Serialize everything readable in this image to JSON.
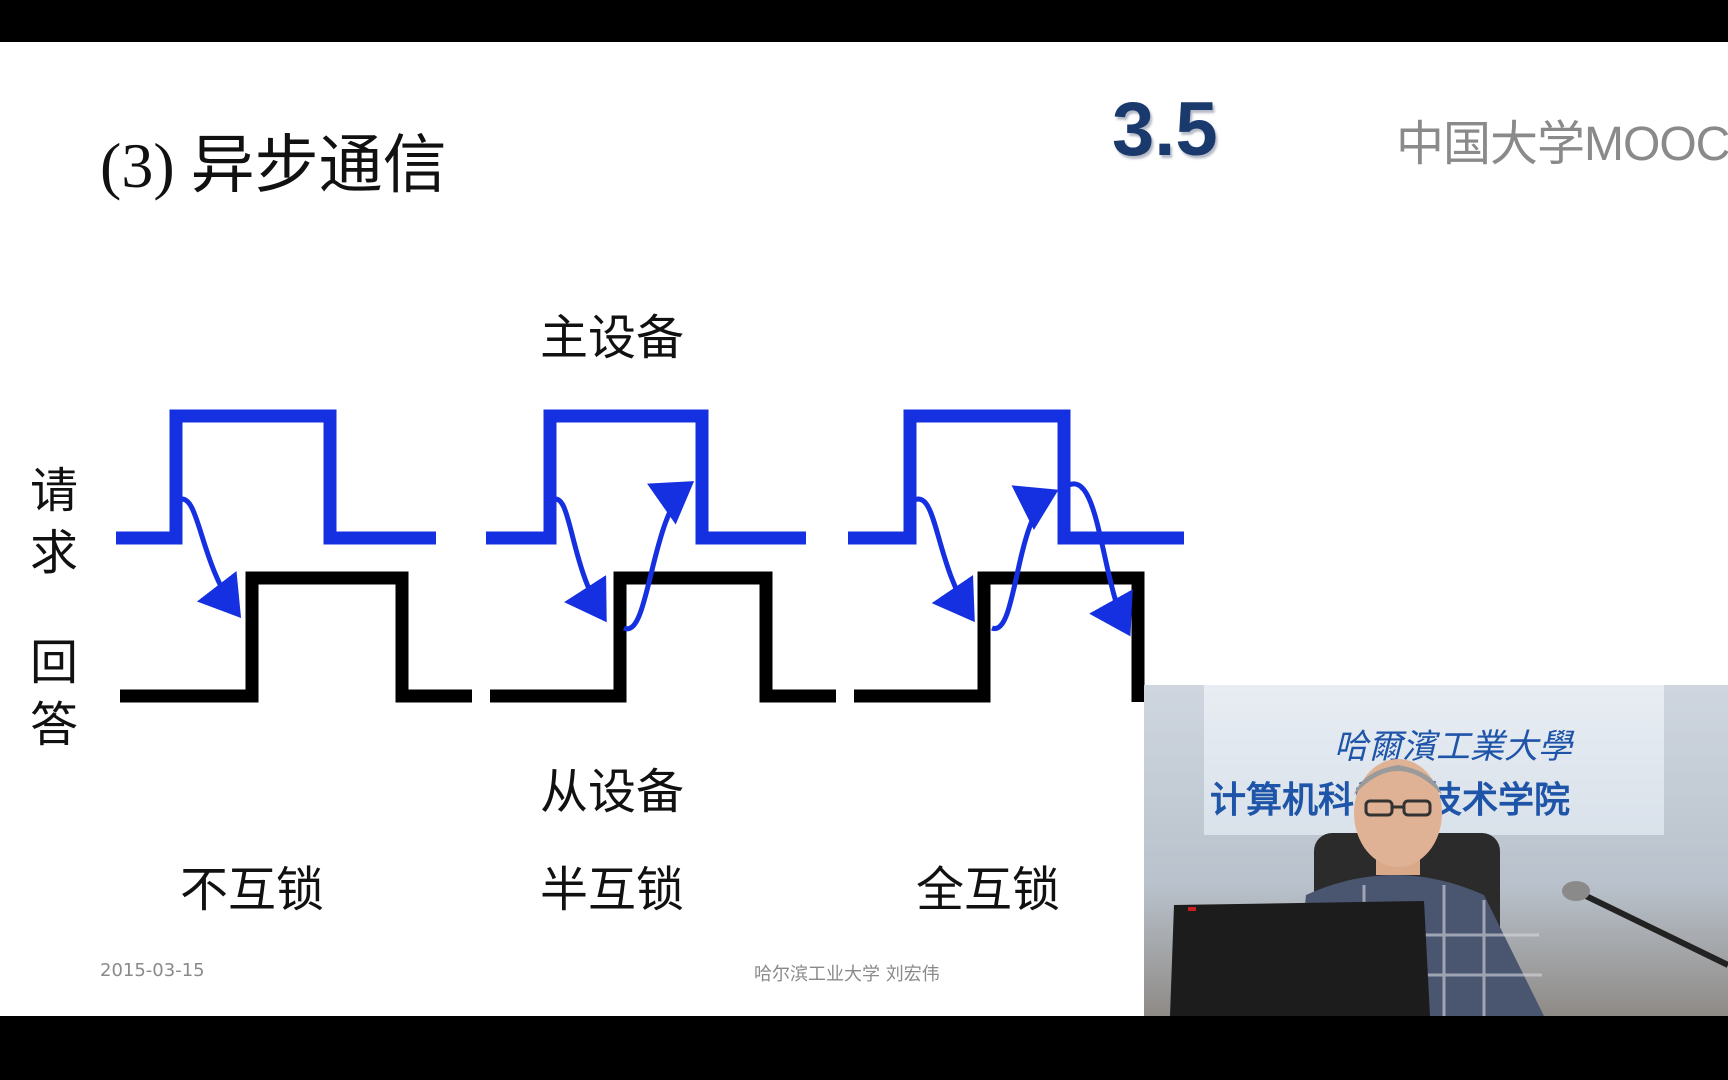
{
  "slide": {
    "title": "(3) 异步通信",
    "section_number": "3.5",
    "logo_text": "中国大学MOOC"
  },
  "diagram": {
    "master_label": "主设备",
    "slave_label": "从设备",
    "request_label": [
      "请",
      "求"
    ],
    "response_label": [
      "回",
      "答"
    ],
    "modes": [
      "不互锁",
      "半互锁",
      "全互锁"
    ],
    "colors": {
      "request": "#1530e0",
      "response": "#000000"
    }
  },
  "footer": {
    "date": "2015-03-15",
    "author": "哈尔滨工业大学  刘宏伟"
  },
  "webcam": {
    "banner_line1": "哈爾濱工業大學",
    "banner_line2": "计算机科学与技术学院"
  }
}
